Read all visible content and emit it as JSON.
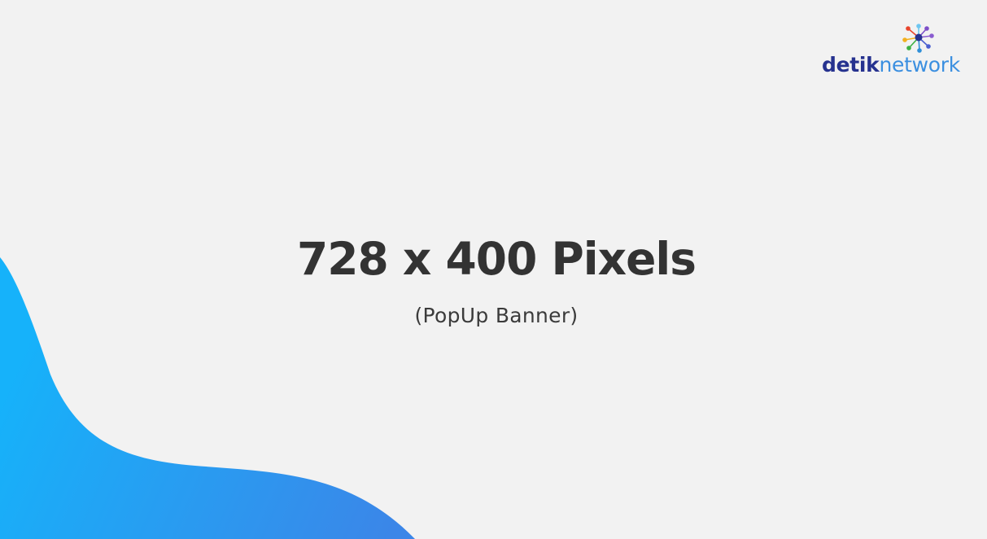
{
  "banner": {
    "headline": "728 x 400 Pixels",
    "subheadline": "(PopUp Banner)",
    "background_color": "#f2f2f2",
    "text_color": "#333333",
    "wave_gradient_colors": [
      "#16b2fa",
      "#3b86e8"
    ]
  },
  "logo": {
    "icon": "network-burst-icon",
    "text_primary": "detik",
    "text_secondary": "network",
    "colors": {
      "primary": "#26328f",
      "secondary": "#3b8fe0"
    }
  }
}
